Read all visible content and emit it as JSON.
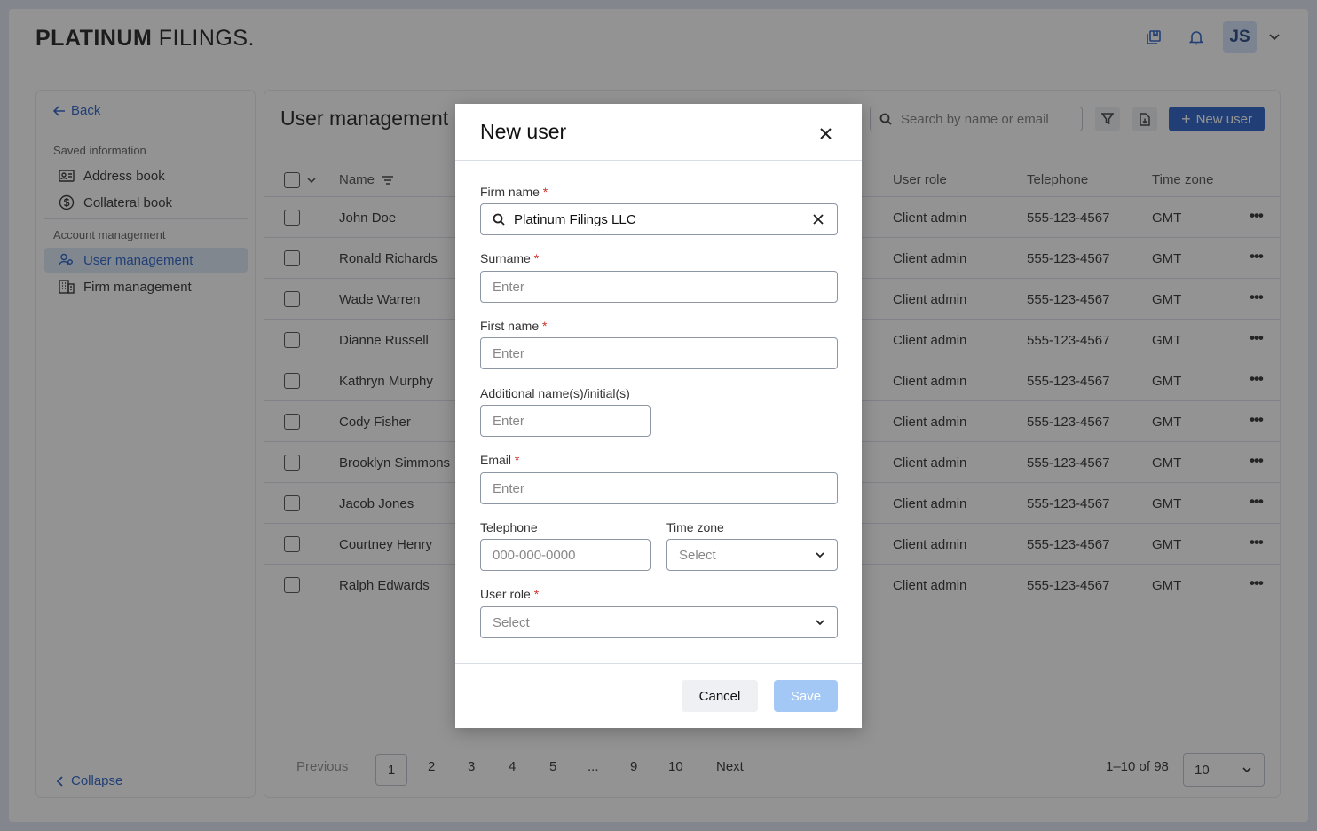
{
  "header": {
    "logo_bold": "PLATINUM",
    "logo_light": "FILINGS.",
    "avatar_initials": "JS"
  },
  "sidebar": {
    "back_label": "Back",
    "saved_section": "Saved information",
    "saved_items": [
      {
        "label": "Address book",
        "icon": "address-book-icon"
      },
      {
        "label": "Collateral book",
        "icon": "dollar-icon"
      }
    ],
    "account_section": "Account management",
    "account_items": [
      {
        "label": "User management",
        "icon": "users-icon",
        "active": true
      },
      {
        "label": "Firm management",
        "icon": "building-icon",
        "active": false
      }
    ],
    "collapse_label": "Collapse"
  },
  "main": {
    "title": "User management",
    "search_placeholder": "Search by name or email",
    "new_user_label": "New user",
    "columns": [
      "Name",
      "User role",
      "Telephone",
      "Time zone"
    ],
    "rows": [
      {
        "name": "John Doe",
        "role": "Client admin",
        "phone": "555-123-4567",
        "tz": "GMT"
      },
      {
        "name": "Ronald Richards",
        "role": "Client admin",
        "phone": "555-123-4567",
        "tz": "GMT"
      },
      {
        "name": "Wade Warren",
        "role": "Client admin",
        "phone": "555-123-4567",
        "tz": "GMT"
      },
      {
        "name": "Dianne Russell",
        "role": "Client admin",
        "phone": "555-123-4567",
        "tz": "GMT"
      },
      {
        "name": "Kathryn Murphy",
        "role": "Client admin",
        "phone": "555-123-4567",
        "tz": "GMT"
      },
      {
        "name": "Cody Fisher",
        "role": "Client admin",
        "phone": "555-123-4567",
        "tz": "GMT"
      },
      {
        "name": "Brooklyn Simmons",
        "role": "Client admin",
        "phone": "555-123-4567",
        "tz": "GMT"
      },
      {
        "name": "Jacob Jones",
        "role": "Client admin",
        "phone": "555-123-4567",
        "tz": "GMT"
      },
      {
        "name": "Courtney Henry",
        "role": "Client admin",
        "phone": "555-123-4567",
        "tz": "GMT"
      },
      {
        "name": "Ralph Edwards",
        "role": "Client admin",
        "phone": "555-123-4567",
        "tz": "GMT"
      }
    ],
    "more_glyph": "•••"
  },
  "pagination": {
    "previous": "Previous",
    "pages": [
      "1",
      "2",
      "3",
      "4",
      "5",
      "...",
      "9",
      "10"
    ],
    "current": "1",
    "next": "Next",
    "range": "1–10 of 98",
    "per_page": "10"
  },
  "modal": {
    "title": "New user",
    "firm_label": "Firm name",
    "firm_value": "Platinum Filings LLC",
    "surname_label": "Surname",
    "first_name_label": "First name",
    "additional_label": "Additional name(s)/initial(s)",
    "email_label": "Email",
    "telephone_label": "Telephone",
    "telephone_placeholder": "000-000-0000",
    "timezone_label": "Time zone",
    "user_role_label": "User role",
    "enter_placeholder": "Enter",
    "select_placeholder": "Select",
    "required_mark": "*",
    "cancel_label": "Cancel",
    "save_label": "Save"
  },
  "colors": {
    "accent": "#1a56c4",
    "save_disabled": "#a3c8f5",
    "required": "#d0342c"
  }
}
